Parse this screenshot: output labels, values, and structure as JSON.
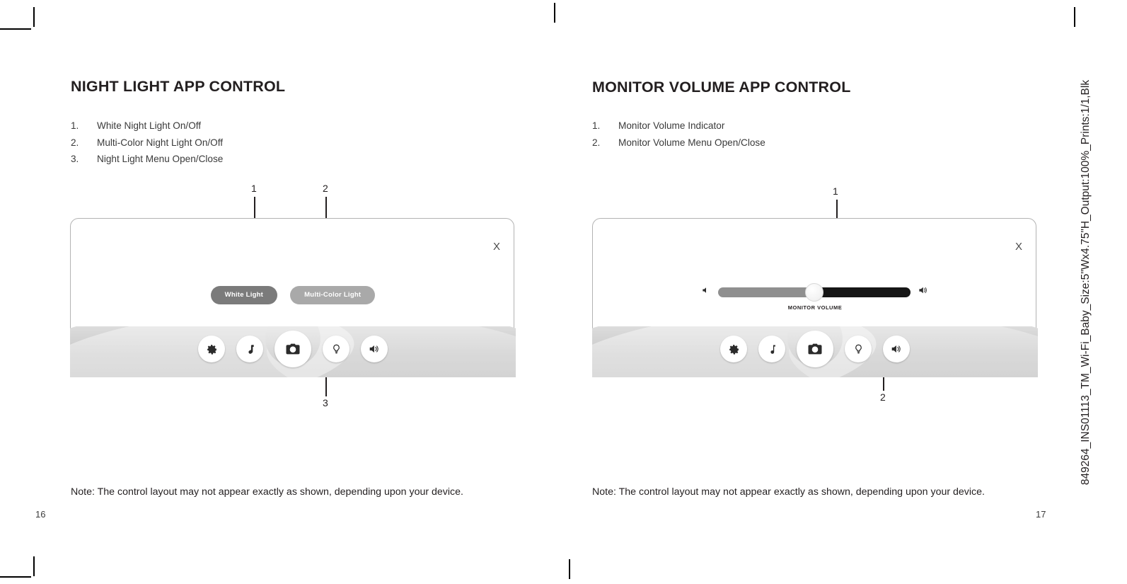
{
  "document": {
    "imprint": "849264_INS01113_TM_Wi-Fi_Baby_Size:5\"Wx4.75\"H_Output:100%_Prints:1/1,Blk"
  },
  "left_page": {
    "folio": "16",
    "heading": "NIGHT LIGHT APP CONTROL",
    "items": [
      {
        "num": "1.",
        "text": "White Night Light On/Off"
      },
      {
        "num": "2.",
        "text": "Multi-Color Night Light On/Off"
      },
      {
        "num": "3.",
        "text": "Night Light Menu Open/Close"
      }
    ],
    "device": {
      "close_label": "X",
      "pills": [
        {
          "label": "White Light",
          "style": "dark"
        },
        {
          "label": "Multi-Color Light",
          "style": "light"
        }
      ],
      "icons": [
        {
          "name": "gear-icon",
          "label": "Settings"
        },
        {
          "name": "music-note-icon",
          "label": "Music"
        },
        {
          "name": "camera-icon",
          "label": "Camera"
        },
        {
          "name": "light-bulb-icon",
          "label": "Night Light"
        },
        {
          "name": "speaker-icon",
          "label": "Volume"
        }
      ],
      "callouts": [
        {
          "num": "1",
          "target": "white-light-pill"
        },
        {
          "num": "2",
          "target": "multi-color-light-pill"
        },
        {
          "num": "3",
          "target": "light-bulb-icon"
        }
      ]
    },
    "note": "Note: The control layout may not appear exactly as shown, depending upon your device."
  },
  "right_page": {
    "folio": "17",
    "heading": "MONITOR VOLUME APP CONTROL",
    "items": [
      {
        "num": "1.",
        "text": "Monitor Volume Indicator"
      },
      {
        "num": "2.",
        "text": "Monitor Volume Menu Open/Close"
      }
    ],
    "device": {
      "close_label": "X",
      "slider": {
        "label": "MONITOR VOLUME",
        "value_percent": 50,
        "left_icon": "speaker-low-icon",
        "right_icon": "speaker-high-icon"
      },
      "icons": [
        {
          "name": "gear-icon",
          "label": "Settings"
        },
        {
          "name": "music-note-icon",
          "label": "Music"
        },
        {
          "name": "camera-icon",
          "label": "Camera"
        },
        {
          "name": "light-bulb-icon",
          "label": "Night Light"
        },
        {
          "name": "speaker-icon",
          "label": "Volume"
        }
      ],
      "callouts": [
        {
          "num": "1",
          "target": "volume-slider-knob"
        },
        {
          "num": "2",
          "target": "speaker-icon"
        }
      ]
    },
    "note": "Note: The control layout may not appear exactly as shown, depending upon your device."
  },
  "colors": {
    "text": "#231f20",
    "pill_dark": "#7b7b7b",
    "pill_light": "#a9a9a9",
    "slider_filled": "#8f8f8f",
    "slider_remainder": "#161616",
    "band_top": "#e9e9e9",
    "band_bottom": "#bdbdbd"
  }
}
